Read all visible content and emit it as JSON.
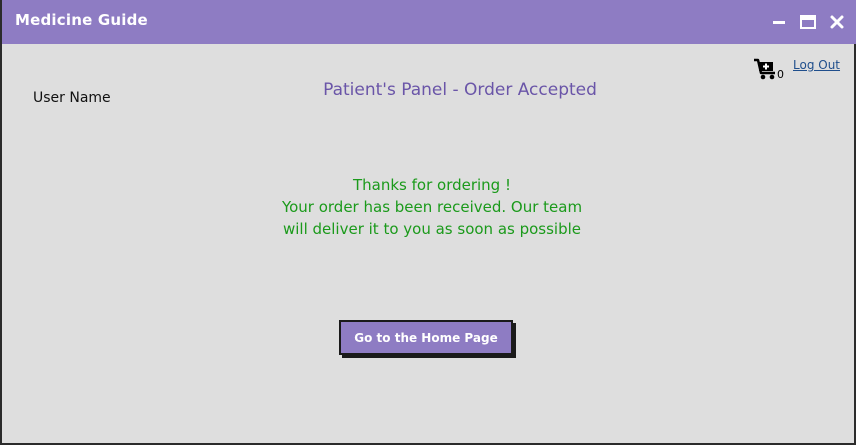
{
  "window": {
    "title": "Medicine Guide",
    "titlebar_color": "#8e7cc3",
    "controls": [
      "minimize-icon",
      "maximize-icon",
      "close-icon"
    ]
  },
  "header": {
    "cart_icon": "cart-icon",
    "cart_count": "0",
    "logout_label": "Log Out",
    "user_name": "User Name"
  },
  "main": {
    "panel_title": "Patient's Panel - Order Accepted",
    "message_lines": [
      "Thanks for ordering !",
      "Your order has been received. Our team",
      "will deliver it to you as soon as possible"
    ],
    "home_button_label": "Go to the Home Page"
  },
  "colors": {
    "accent": "#8e7cc3",
    "panel_title": "#6a55a8",
    "success_text": "#1b9a1b",
    "background": "#dedede"
  }
}
